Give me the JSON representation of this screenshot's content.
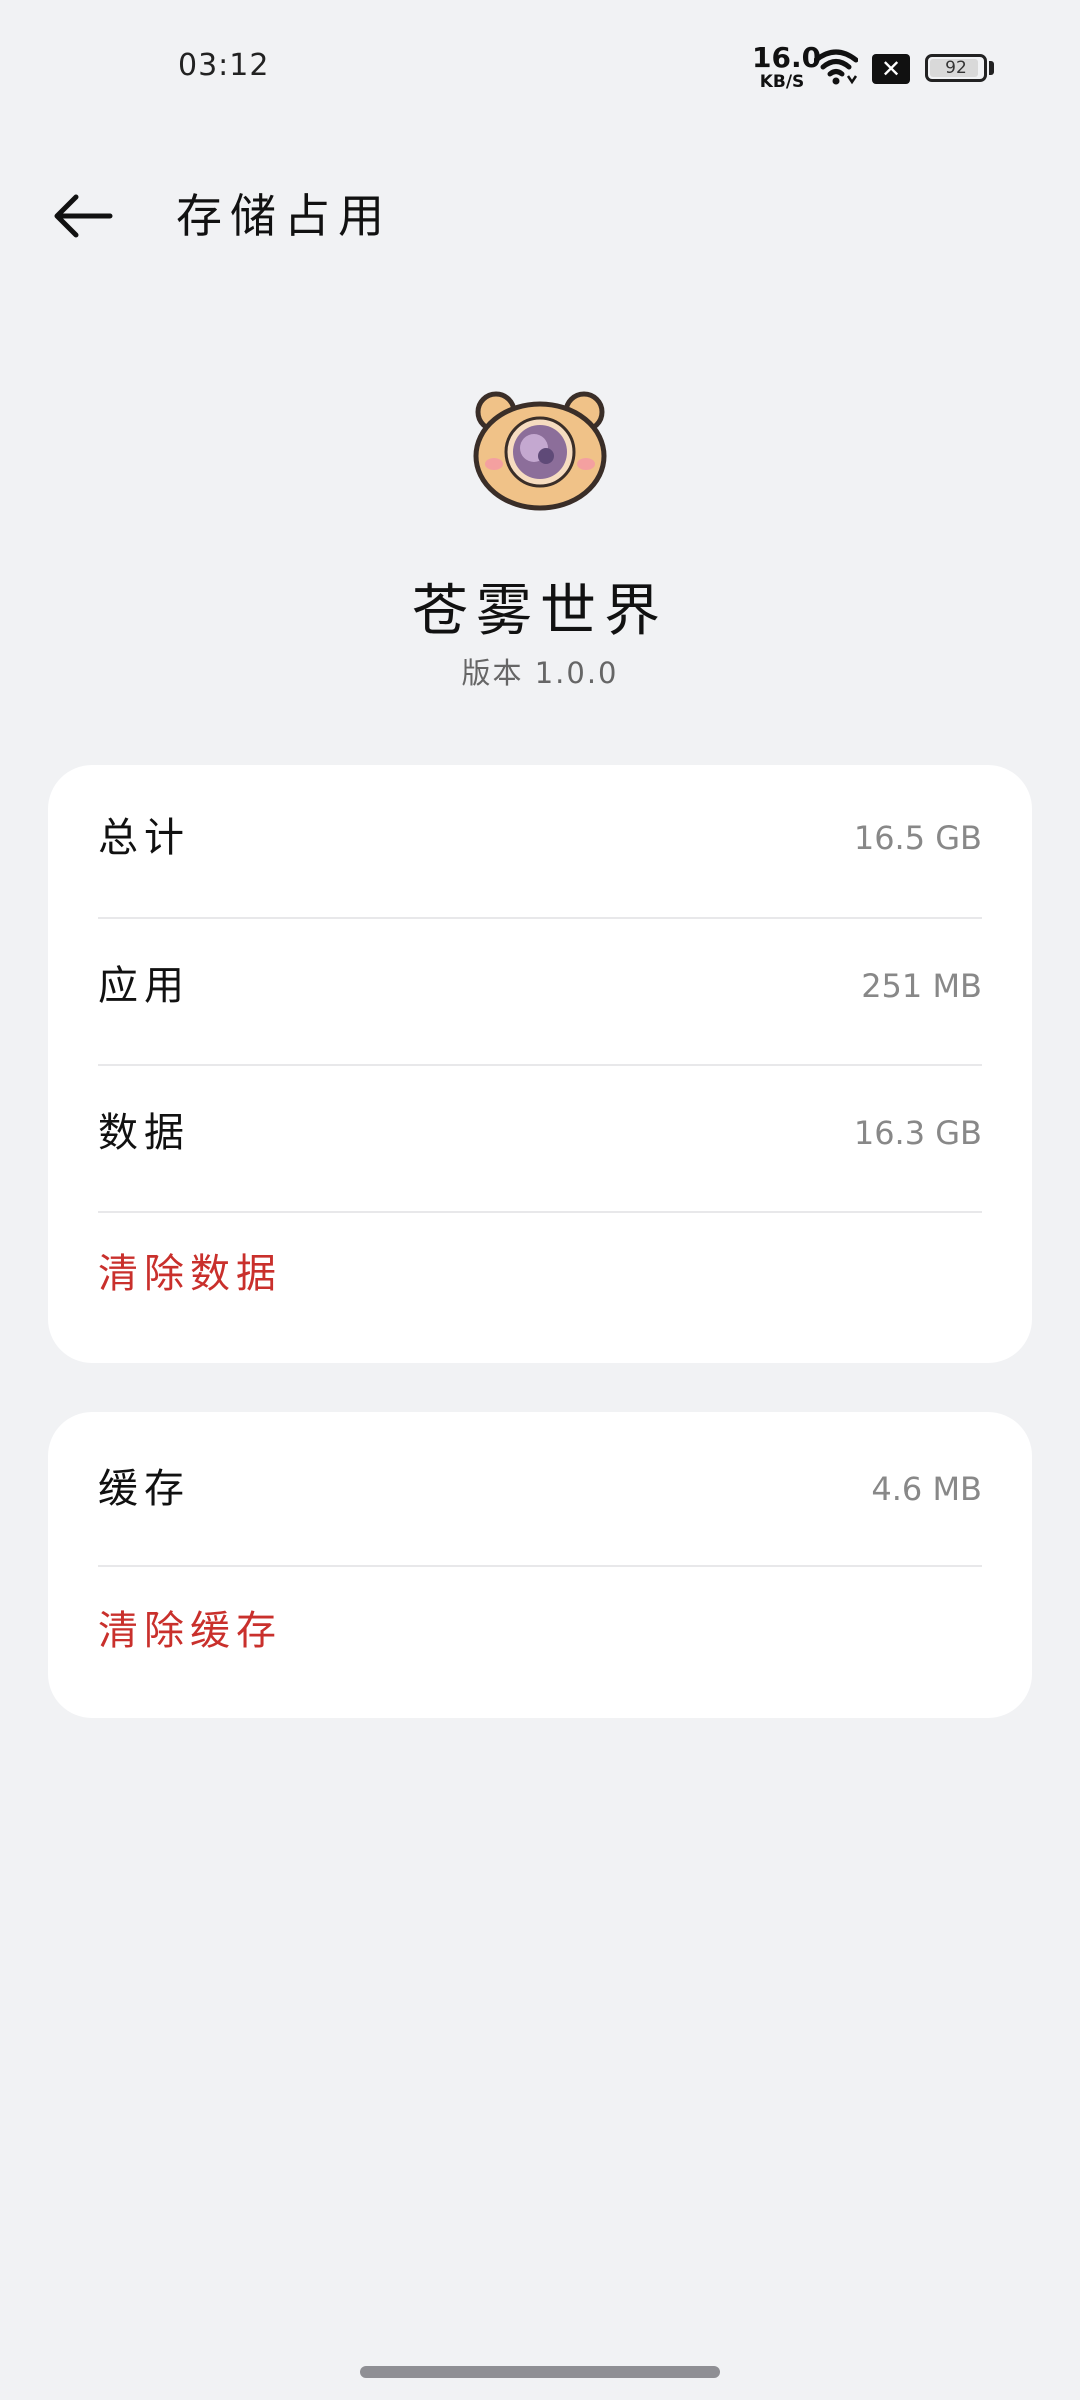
{
  "status_bar": {
    "time": "03:12",
    "net_speed_value": "16.0",
    "net_speed_unit": "KB/S",
    "battery_level": "92",
    "battery_fraction": 0.92
  },
  "header": {
    "title": "存储占用"
  },
  "app": {
    "name": "苍雾世界",
    "version": "版本 1.0.0",
    "icon": "bear-avatar-icon"
  },
  "storage_card": {
    "rows": [
      {
        "label": "总计",
        "value": "16.5 GB"
      },
      {
        "label": "应用",
        "value": "251 MB"
      },
      {
        "label": "数据",
        "value": "16.3 GB"
      }
    ],
    "action": "清除数据"
  },
  "cache_card": {
    "rows": [
      {
        "label": "缓存",
        "value": "4.6 MB"
      }
    ],
    "action": "清除缓存"
  },
  "colors": {
    "background": "#f1f2f4",
    "card": "#ffffff",
    "action_red": "#c9302c",
    "value_gray": "#888888"
  }
}
